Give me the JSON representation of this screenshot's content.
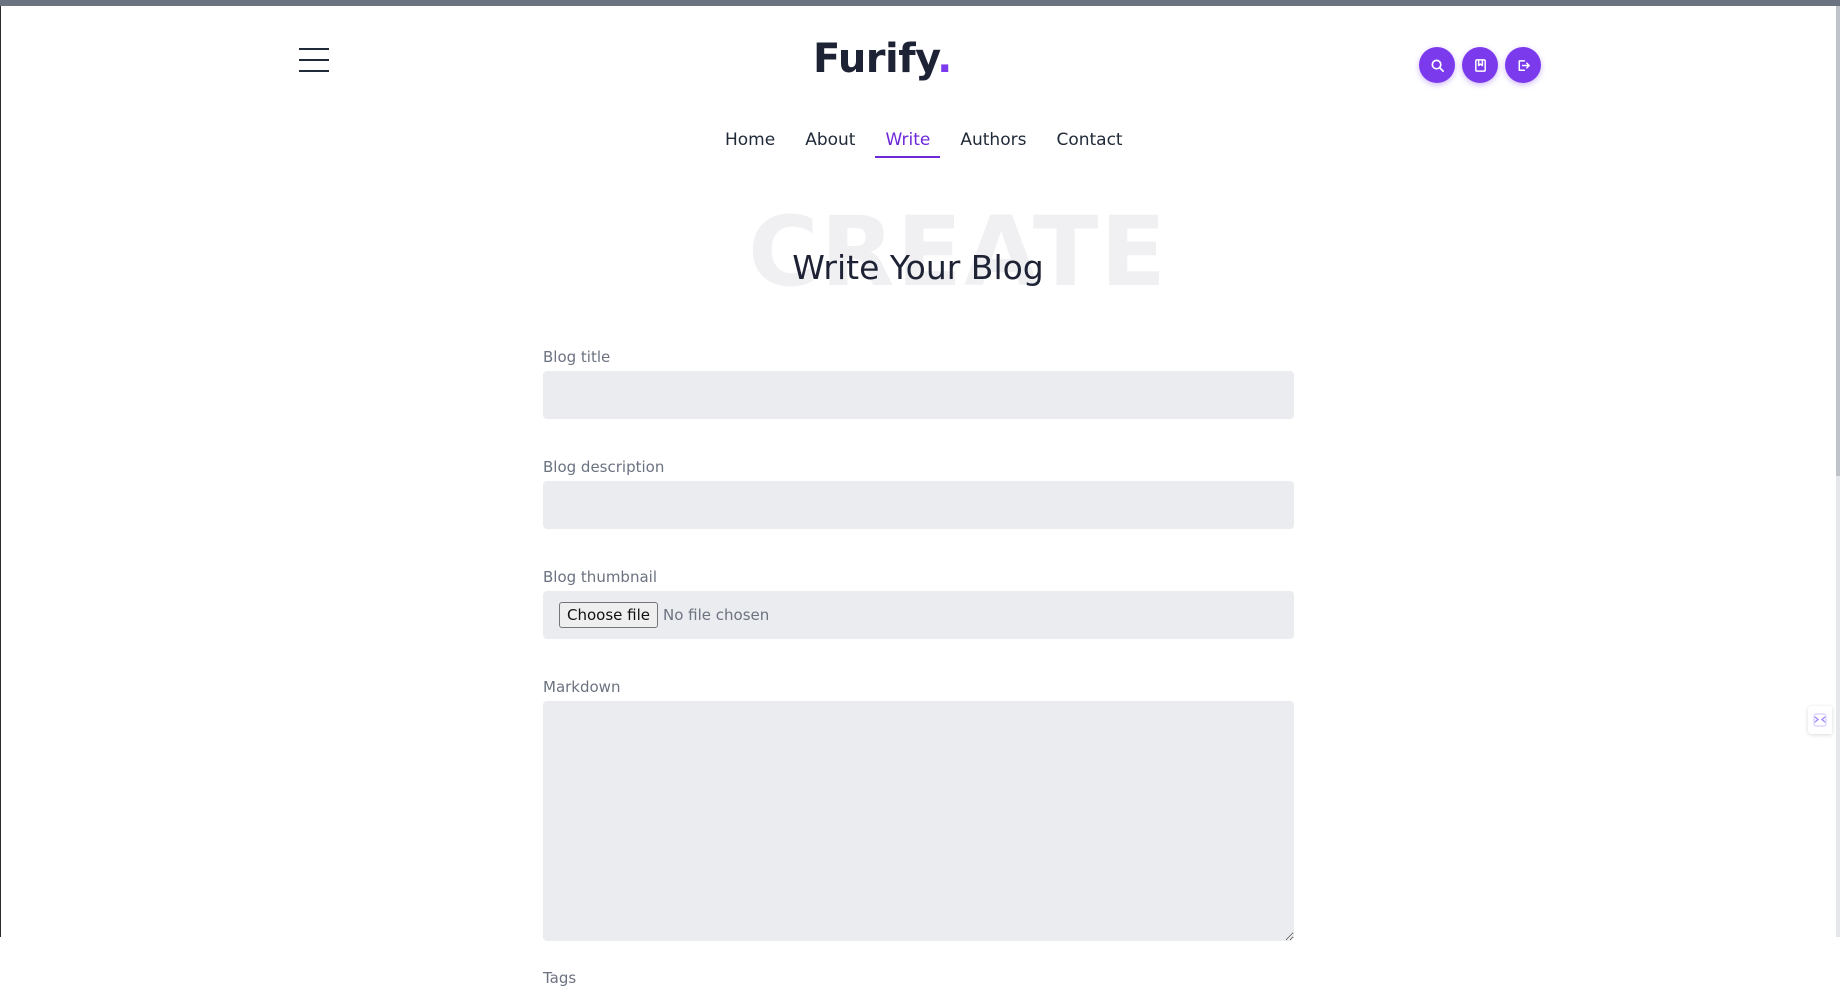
{
  "brand": {
    "name": "Furify",
    "dot": "."
  },
  "header": {
    "icons": [
      {
        "name": "search-icon"
      },
      {
        "name": "bookmark-icon"
      },
      {
        "name": "logout-icon"
      }
    ],
    "accent_color": "#7c3aed"
  },
  "nav": {
    "items": [
      {
        "label": "Home"
      },
      {
        "label": "About"
      },
      {
        "label": "Write",
        "active": true
      },
      {
        "label": "Authors"
      },
      {
        "label": "Contact"
      }
    ]
  },
  "hero": {
    "background_word": "CREATE",
    "title": "Write Your Blog"
  },
  "form": {
    "title_label": "Blog title",
    "title_value": "",
    "description_label": "Blog description",
    "description_value": "",
    "thumbnail_label": "Blog thumbnail",
    "thumbnail_button": "Choose file",
    "thumbnail_status": "No file chosen",
    "markdown_label": "Markdown",
    "markdown_value": "",
    "tags_label": "Tags"
  }
}
